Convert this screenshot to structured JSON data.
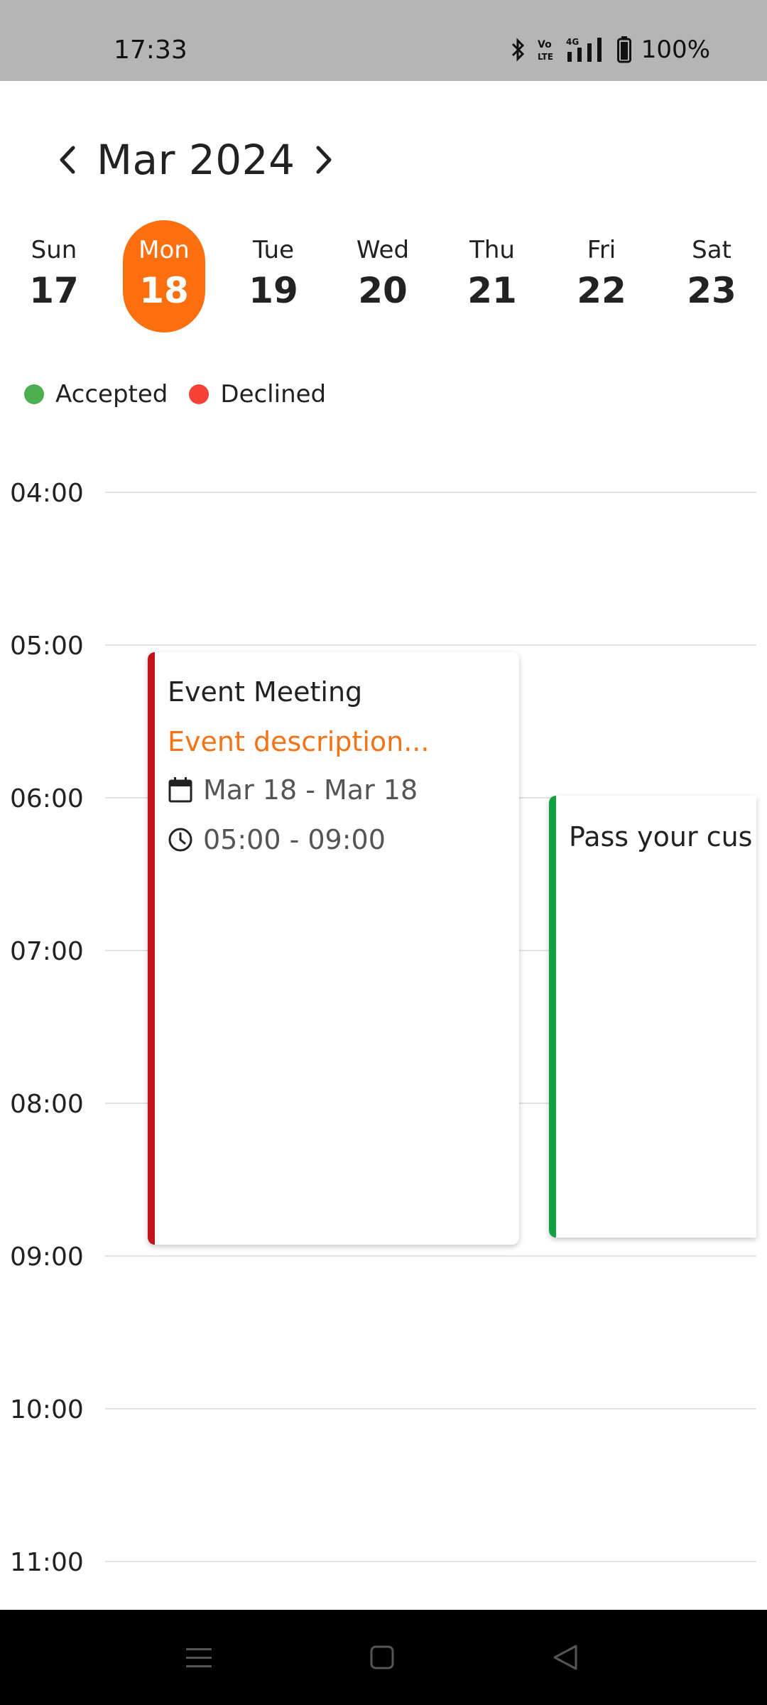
{
  "status_bar": {
    "time": "17:33",
    "battery": "100%",
    "icons": [
      "bluetooth-icon",
      "volte-icon",
      "signal-4g-icon",
      "battery-icon"
    ]
  },
  "calendar": {
    "month_label": "Mar 2024",
    "prev_icon": "chevron-left-icon",
    "next_icon": "chevron-right-icon",
    "week": [
      {
        "name": "Sun",
        "num": "17",
        "selected": false
      },
      {
        "name": "Mon",
        "num": "18",
        "selected": true
      },
      {
        "name": "Tue",
        "num": "19",
        "selected": false
      },
      {
        "name": "Wed",
        "num": "20",
        "selected": false
      },
      {
        "name": "Thu",
        "num": "21",
        "selected": false
      },
      {
        "name": "Fri",
        "num": "22",
        "selected": false
      },
      {
        "name": "Sat",
        "num": "23",
        "selected": false
      }
    ],
    "accent_color": "#fb6f0f"
  },
  "legend": {
    "accepted": {
      "label": "Accepted",
      "color": "#4caf50"
    },
    "declined": {
      "label": "Declined",
      "color": "#f44336"
    }
  },
  "timeline": {
    "hours": [
      "04:00",
      "05:00",
      "06:00",
      "07:00",
      "08:00",
      "09:00",
      "10:00",
      "11:00"
    ]
  },
  "events": [
    {
      "title": "Event Meeting",
      "description": "Event description...",
      "dates": "Mar 18 - Mar 18",
      "times": "05:00 - 09:00",
      "status_color": "#c0141a"
    },
    {
      "title": "Pass your cus",
      "status_color": "#12a040"
    }
  ],
  "nav_bar": {
    "icons": [
      "menu-icon",
      "home-square-icon",
      "back-triangle-icon"
    ]
  }
}
